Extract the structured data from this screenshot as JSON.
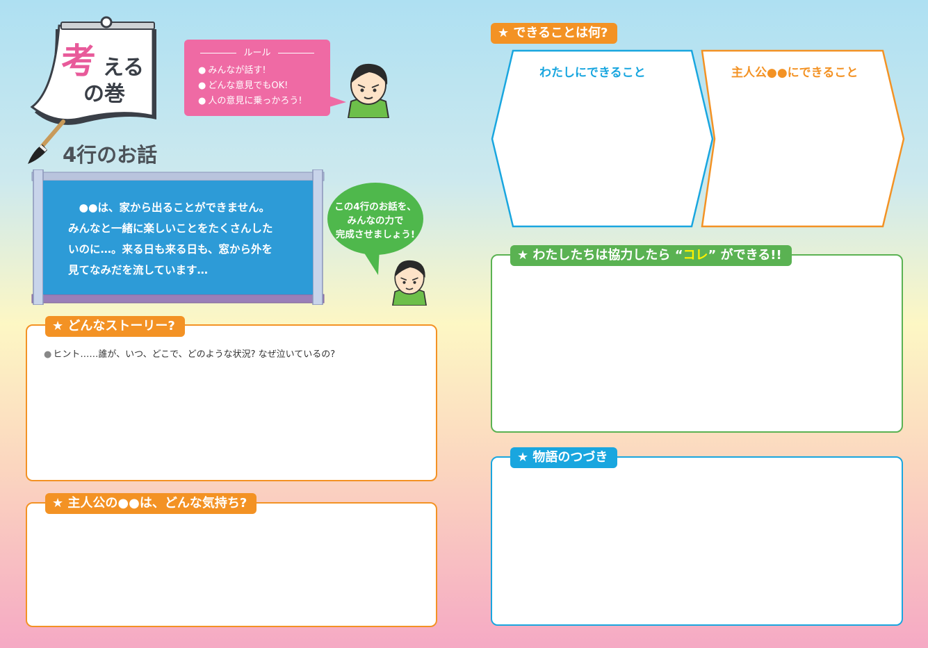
{
  "header": {
    "title_char": "考",
    "title_rest": "える",
    "title_sub": "の巻"
  },
  "rules": {
    "title": "ルール",
    "items": [
      "みんなが話す!",
      "どんな意見でもOK!",
      "人の意見に乗っかろう!"
    ]
  },
  "story": {
    "title": "4行のお話",
    "lines": [
      "　●●は、家から出ることができません。",
      "みんなと一緒に楽しいことをたくさんした",
      "いのに…。来る日も来る日も、窓から外を",
      "見てなみだを流しています…"
    ]
  },
  "bubble": {
    "lines": [
      "この4行のお話を、",
      "みんなの力で",
      "完成させましょう!"
    ]
  },
  "sections": {
    "what_story": {
      "title": "★ どんなストーリー?",
      "hint": "ヒント……誰が、いつ、どこで、どのような状況? なぜ泣いているの?"
    },
    "feelings": {
      "title": "★ 主人公の●●は、どんな気持ち?"
    },
    "can_do": {
      "title": "★ できることは何?",
      "left_label": "わたしにできること",
      "right_label": "主人公●●にできること"
    },
    "together": {
      "title_a": "★ わたしたちは協力したら",
      "title_q1": "“",
      "title_hl": "コレ",
      "title_q2": "”",
      "title_b": "ができる!!"
    },
    "continuation": {
      "title": "★ 物語のつづき"
    }
  },
  "colors": {
    "orange": "#f39224",
    "green": "#5ab252",
    "blue": "#19a6df",
    "pink": "#ef6aa4",
    "highlight": "#fff100"
  }
}
